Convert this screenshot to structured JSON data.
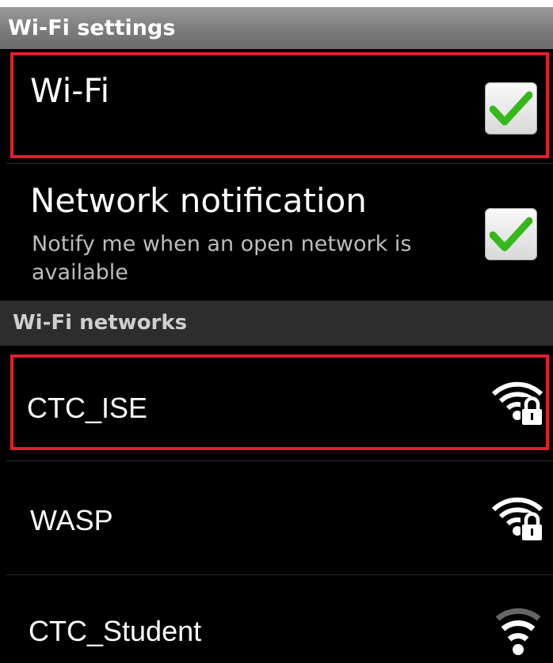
{
  "header": {
    "title": "Wi-Fi settings"
  },
  "wifi_toggle": {
    "label": "Wi-Fi",
    "checked": true
  },
  "network_notification": {
    "title": "Network notification",
    "summary": "Notify me when an open network is available",
    "checked": true
  },
  "networks_section": {
    "title": "Wi-Fi networks"
  },
  "networks": [
    {
      "name": "CTC_ISE",
      "secured": true,
      "signal_icon": "wifi-lock-icon"
    },
    {
      "name": "WASP",
      "secured": true,
      "signal_icon": "wifi-lock-icon"
    },
    {
      "name": "CTC_Student",
      "secured": false,
      "signal_icon": "wifi-icon"
    }
  ],
  "colors": {
    "highlight": "#e01f2e",
    "check": "#35b81a",
    "header_bg": "#8a8a8a",
    "section_bg": "#2d2d2d"
  }
}
